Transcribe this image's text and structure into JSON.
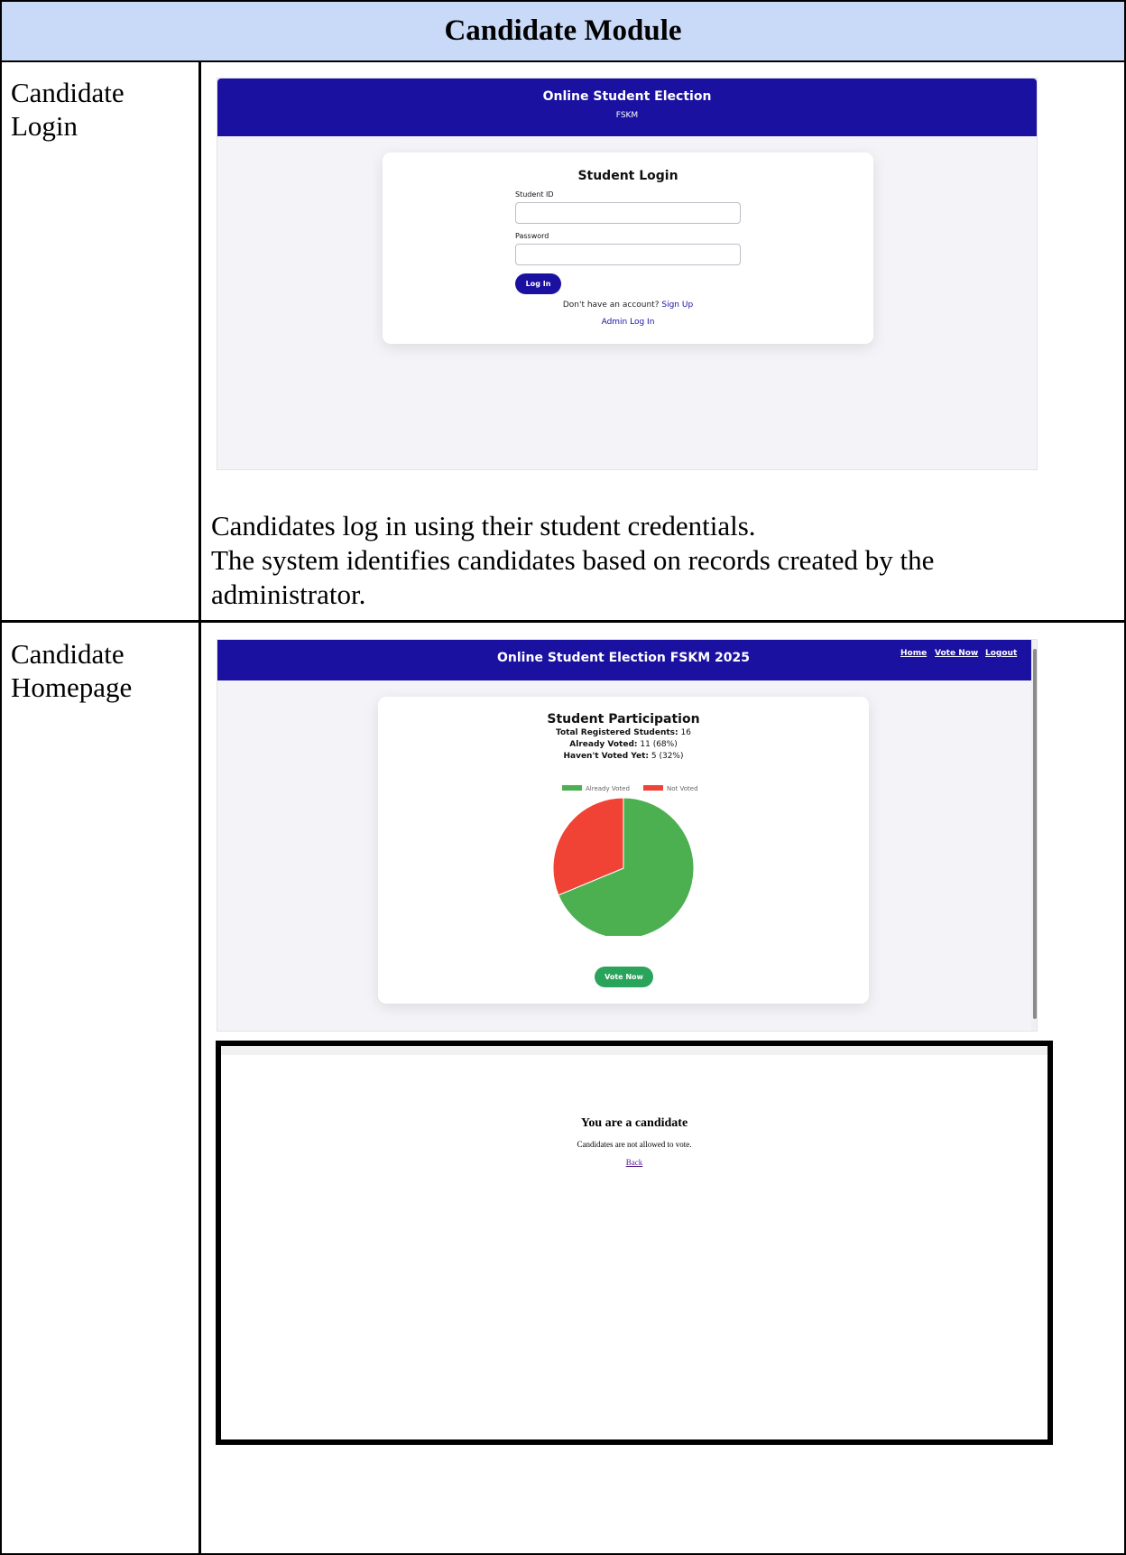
{
  "document": {
    "title": "Candidate Module",
    "rows": [
      {
        "label": "Candidate Login",
        "description_lines": [
          "Candidates log in using their student credentials.",
          "The system identifies candidates based on records created by the",
          "administrator."
        ]
      },
      {
        "label": "Candidate Homepage"
      }
    ]
  },
  "login_screen": {
    "banner_title": "Online Student Election",
    "banner_subtitle": "FSKM",
    "card_title": "Student Login",
    "student_id_label": "Student ID",
    "password_label": "Password",
    "login_button": "Log In",
    "signup_prompt": "Don't have an account?",
    "signup_link": "Sign Up",
    "admin_link": "Admin Log In"
  },
  "home_screen": {
    "banner_title": "Online Student Election FSKM 2025",
    "nav": [
      "Home",
      "Vote Now",
      "Logout"
    ],
    "card_title": "Student Participation",
    "stats": [
      {
        "label": "Total Registered Students:",
        "value": "16"
      },
      {
        "label": "Already Voted:",
        "value": "11 (68%)"
      },
      {
        "label": "Haven't Voted Yet:",
        "value": "5 (32%)"
      }
    ],
    "vote_button": "Vote Now"
  },
  "chart_data": {
    "type": "pie",
    "labels": [
      "Already Voted",
      "Not Voted"
    ],
    "values": [
      11,
      5
    ],
    "colors": [
      "#4caf50",
      "#f04235"
    ],
    "legend": "top"
  },
  "candidate_screen": {
    "title": "You are a candidate",
    "message": "Candidates are not allowed to vote.",
    "back_link": "Back"
  }
}
